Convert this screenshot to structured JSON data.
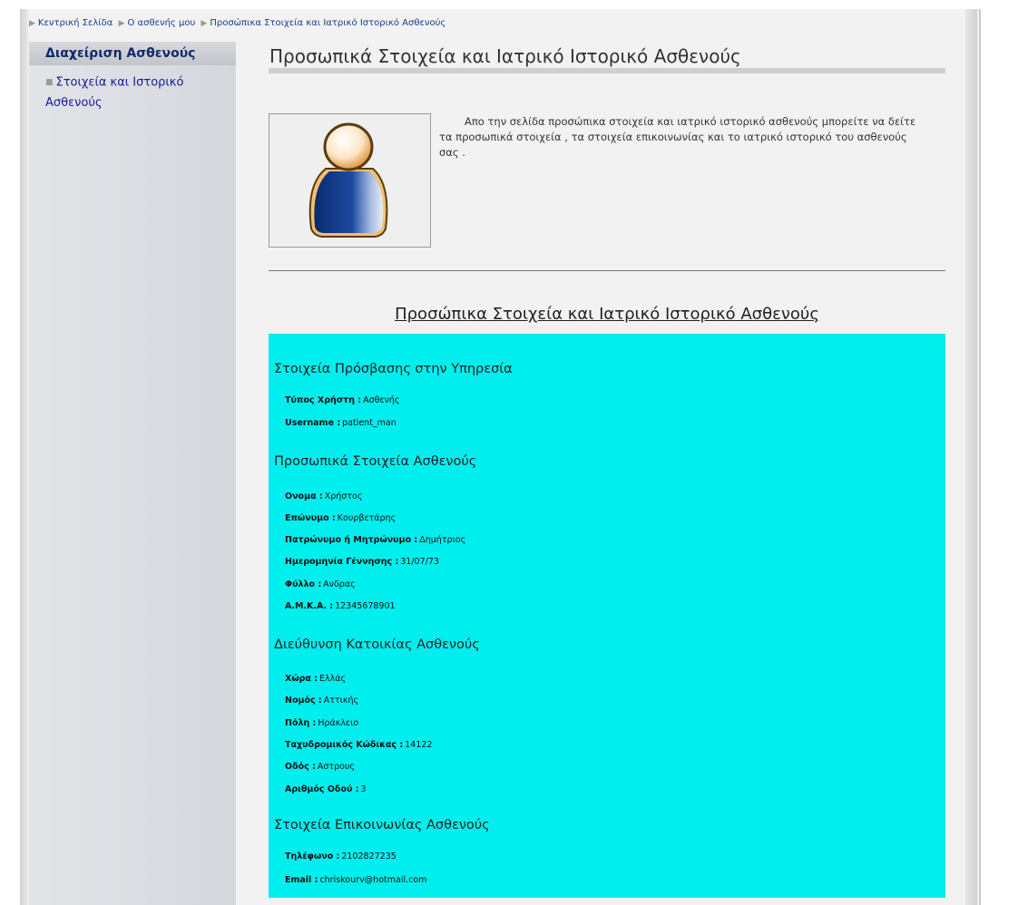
{
  "breadcrumb": [
    "Κεντρική Σελίδα",
    "Ο ασθενής μου",
    "Προσώπικα Στοιχεία και Ιατρικό Ιστορικό Ασθενούς"
  ],
  "sidebar": {
    "heading": "Διαχείριση Ασθενούς",
    "item": "Στοιχεία και Ιστορικό Ασθενούς"
  },
  "main": {
    "title": "Προσωπικά Στοιχεία και Ιατρικό Ιστορικό Ασθενούς",
    "intro": "Απο την σελίδα προσώπικα στοιχεία και ιατρικό ιστορικό ασθενούς μπορείτε να δείτε τα προσωπικά στοιχεία , τα στοιχεία επικοινωνίας και το ιατρικό ιστορικό του ασθενούς σας .",
    "section_title": "Προσώπικα Στοιχεία και Ιατρικό Ιστορικό Ασθενούς"
  },
  "access": {
    "heading": "Στοιχεία Πρόσβασης στην Υπηρεσία",
    "user_type_label": "Τύπος Χρήστη :",
    "user_type": "Ασθενής",
    "username_label": "Username :",
    "username": "patient_man"
  },
  "personal": {
    "heading": "Προσωπικά Στοιχεία Ασθενούς",
    "first_name_label": "Ονομα :",
    "first_name": "Χρήστος",
    "last_name_label": "Επώνυμο :",
    "last_name": "Κουρβετάρης",
    "parent_name_label": "Πατρώνυμο ή Μητρώνυμο :",
    "parent_name": "Δημήτριος",
    "birth_label": "Ημερομηνία Γέννησης :",
    "birth": "31/07/73",
    "gender_label": "Φύλλο :",
    "gender": "Ανδρας",
    "amka_label": "Α.Μ.Κ.Α. :",
    "amka": "12345678901"
  },
  "address": {
    "heading": "Διεύθυνση Κατοικίας Ασθενούς",
    "country_label": "Χώρα :",
    "country": "Ελλάς",
    "prefecture_label": "Νομός :",
    "prefecture": "Αττικής",
    "city_label": "Πόλη :",
    "city": "Ηράκλειο",
    "postal_label": "Ταχυδρομικός Κώδικας :",
    "postal": "14122",
    "street_label": "Οδός :",
    "street": "Αστρους",
    "number_label": "Αριθμός Οδού :",
    "number": "3"
  },
  "contact": {
    "heading": "Στοιχεία Επικοινωνίας Ασθενούς",
    "phone_label": "Τηλέφωνο :",
    "phone": "2102827235",
    "email_label": "Email :",
    "email": "chriskourv@hotmail.com"
  },
  "colors": {
    "info_box": "#00eeee",
    "link": "#1a1a9c"
  },
  "icons": [
    "breadcrumb-arrow-icon",
    "bullet-icon",
    "patient-avatar-icon"
  ]
}
